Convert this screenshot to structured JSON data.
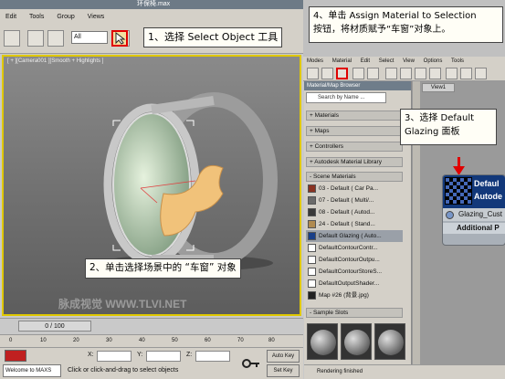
{
  "app": {
    "title": "环保椅.max",
    "menus": [
      "Edit",
      "Tools",
      "Group",
      "Views"
    ],
    "selection_filter": "All",
    "viewport_label": "[ + ][Camera001 ][Smooth + Highlights ]",
    "watermark": "脉成视觉 WWW.TLVI.NET",
    "frames": "0 / 100",
    "ruler_ticks": [
      "0",
      "10",
      "20",
      "30",
      "40",
      "50",
      "60",
      "70",
      "80"
    ],
    "x_label": "X:",
    "y_label": "Y:",
    "z_label": "Z:",
    "auto_key": "Auto Key",
    "set_key": "Set Key",
    "welcome": "Welcome to MAXS",
    "prompt": "Click or click-and-drag to select objects"
  },
  "material_editor": {
    "menus": [
      "Modes",
      "Material",
      "Edit",
      "Select",
      "View",
      "Options",
      "Tools"
    ],
    "browser_title": "Material/Map Browser",
    "search_placeholder": "Search by Name ...",
    "categories": [
      "+ Materials",
      "+ Maps",
      "+ Controllers",
      "+ Autodesk Material Library",
      "- Scene Materials"
    ],
    "scene_materials": [
      {
        "label": "03 - Default ( Car Pa...",
        "color": "#8a3322"
      },
      {
        "label": "07 - Default ( Multi/...",
        "color": "#6a6a6a"
      },
      {
        "label": "08 - Default ( Autod...",
        "color": "#3a3a3a"
      },
      {
        "label": "24 - Default ( Stand...",
        "color": "#b08a50"
      },
      {
        "label": "Default Glazing ( Auto...",
        "color": "#1a3f88"
      },
      {
        "label": "DefaultContourContr...",
        "color": "#ffffff"
      },
      {
        "label": "DefaultContourOutpu...",
        "color": "#ffffff"
      },
      {
        "label": "DefaultContourStoreS...",
        "color": "#ffffff"
      },
      {
        "label": "DefaultOutputShader...",
        "color": "#ffffff"
      },
      {
        "label": "Map #26 (背景.jpg)",
        "color": "#222222"
      }
    ],
    "sample_slots_label": "- Sample Slots",
    "view_tab": "View1",
    "node_title_1": "Defaul",
    "node_title_2": "Autode",
    "node_slot": "Glazing_Cust",
    "node_extra": "Additional P",
    "render_status": "Rendering finished"
  },
  "callouts": {
    "step1": "1、选择 Select Object 工具",
    "step2_line1": "4、单击 Assign Material to Selection",
    "step2_line2": "按钮，将材质赋予“车窗”对象上。",
    "step3_line1": "3、选择  Default",
    "step3_line2": "Glazing 面板",
    "step4": "2、单击选择场景中的 “车窗” 对象"
  },
  "colors": {
    "highlight_red": "#e00000",
    "node_blue": "#12387a"
  }
}
